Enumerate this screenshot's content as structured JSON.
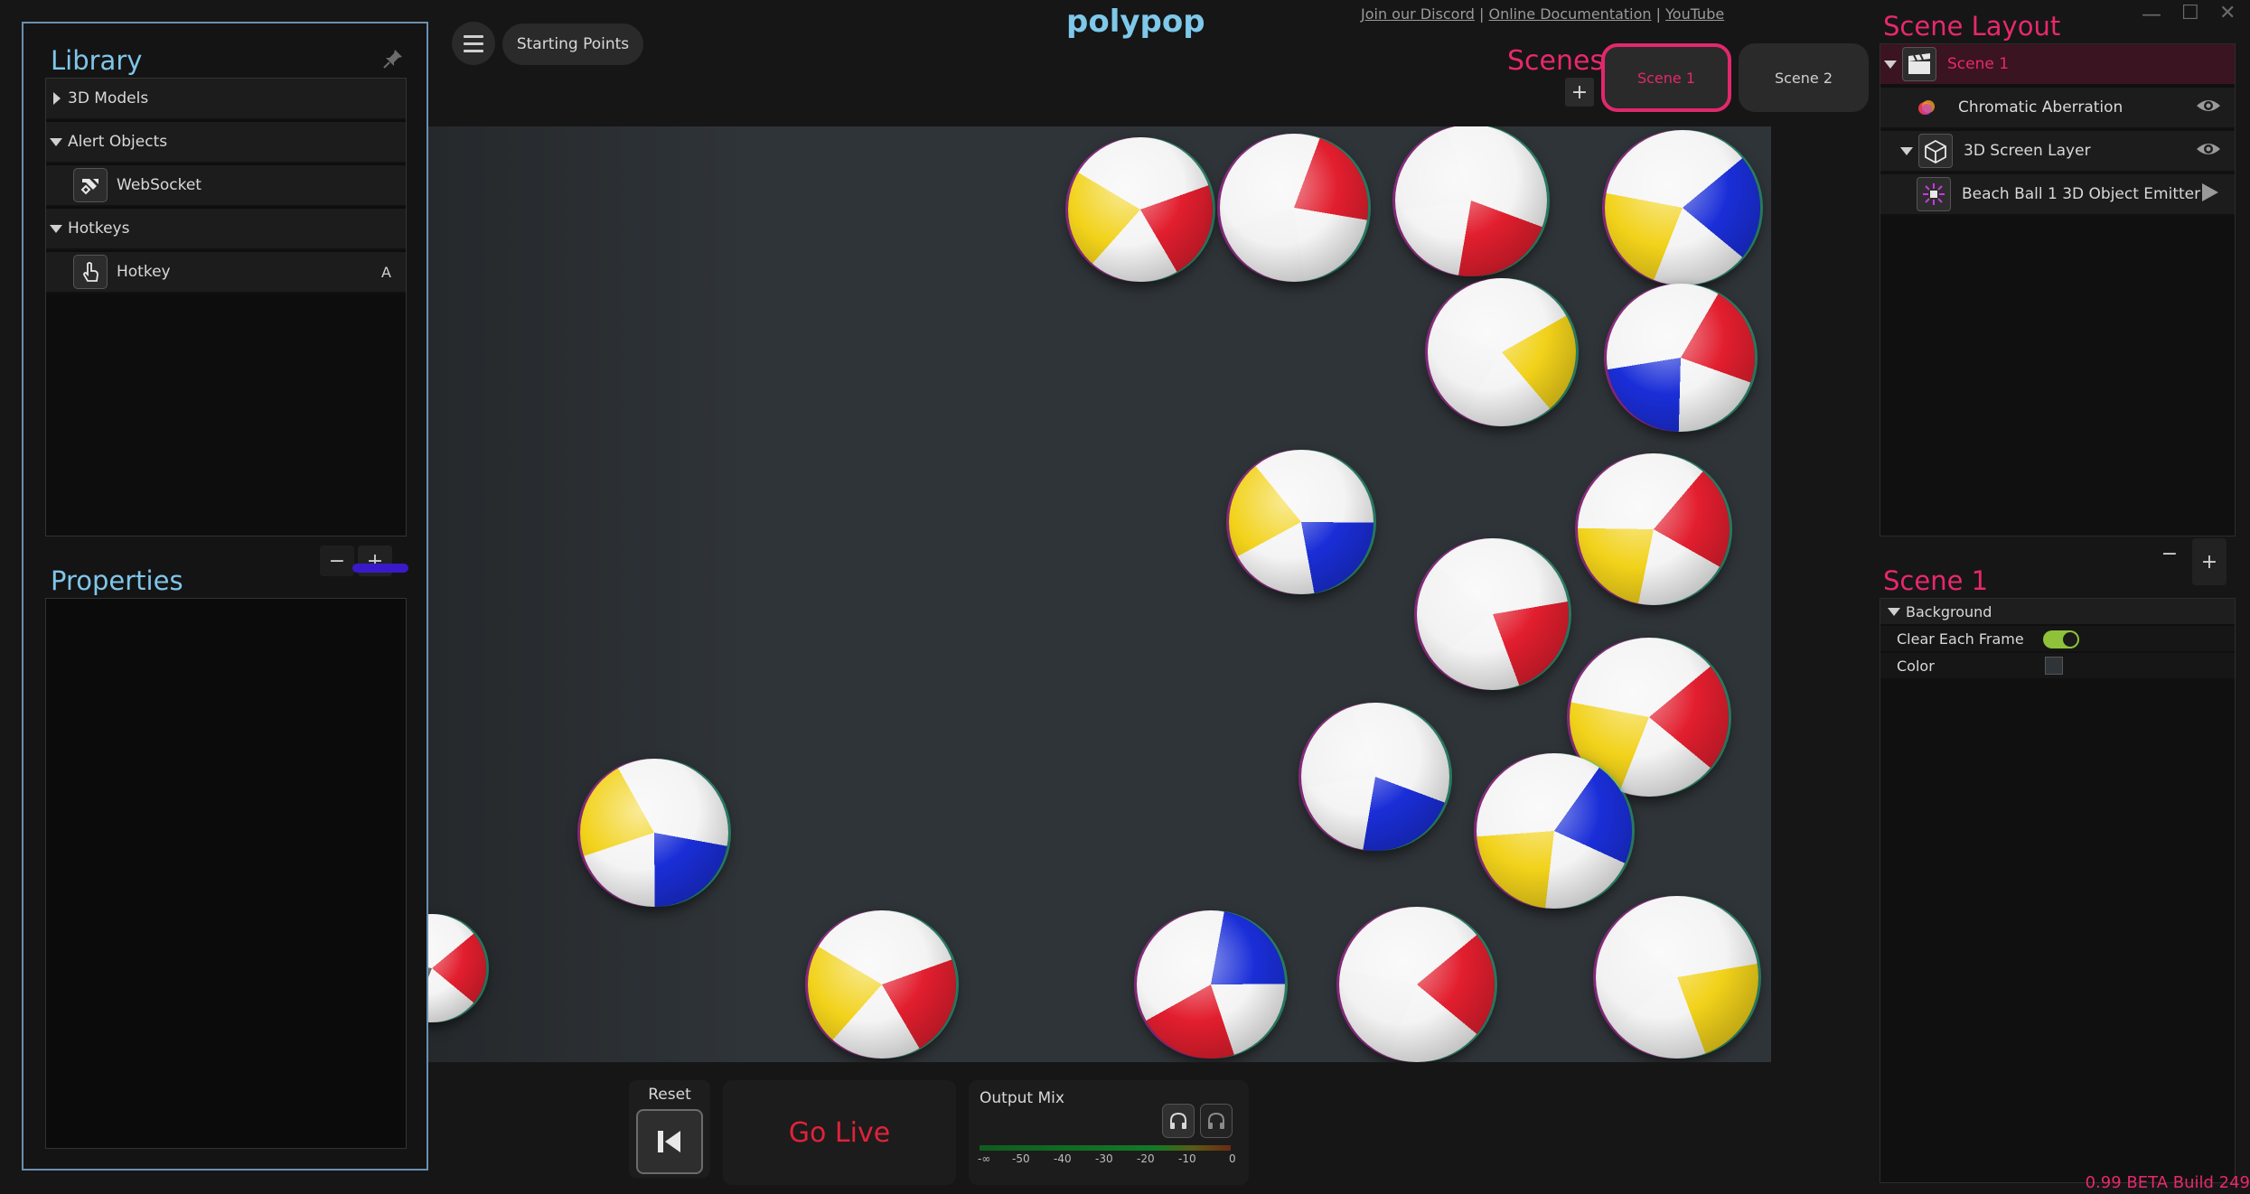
{
  "app": {
    "logo": "polypop",
    "build": "0.99 BETA Build 249"
  },
  "top_links": {
    "discord": "Join our Discord",
    "docs": "Online Documentation",
    "youtube": "YouTube",
    "separator": "|"
  },
  "toolbar": {
    "starting_points": "Starting Points"
  },
  "library": {
    "title": "Library",
    "rows": [
      {
        "label": "3D Models",
        "type": "category-collapsed"
      },
      {
        "label": "Alert Objects",
        "type": "category-expanded"
      },
      {
        "label": "WebSocket",
        "type": "item",
        "icon": "websocket-icon"
      },
      {
        "label": "Hotkeys",
        "type": "category-expanded"
      },
      {
        "label": "Hotkey",
        "type": "item",
        "icon": "hand-pointer-icon",
        "key": "A"
      }
    ],
    "remove_label": "−",
    "add_label": "+"
  },
  "properties": {
    "title": "Properties"
  },
  "scenes": {
    "label": "Scenes",
    "add_label": "+",
    "items": [
      {
        "label": "Scene 1",
        "active": true
      },
      {
        "label": "Scene 2",
        "active": false
      }
    ]
  },
  "scene_layout": {
    "title": "Scene Layout",
    "rows": [
      {
        "label": "Scene 1",
        "icon": "clapperboard-icon",
        "selected": true
      },
      {
        "label": "Chromatic Aberration",
        "icon": "chromatic-aberration-icon"
      },
      {
        "label": "3D Screen Layer",
        "icon": "cube-icon"
      },
      {
        "label": "Beach Ball 1 3D Object Emitter",
        "icon": "emitter-icon"
      }
    ],
    "remove_label": "−",
    "add_label": "+"
  },
  "scene_props": {
    "title": "Scene 1",
    "section": "Background",
    "clear_each_frame_label": "Clear Each Frame",
    "clear_each_frame": true,
    "color_label": "Color",
    "color_value": "#2f3438"
  },
  "controls": {
    "reset_label": "Reset",
    "go_live": "Go Live",
    "output_mix": "Output Mix",
    "meter_ticks": [
      "-∞",
      "-50",
      "-40",
      "-30",
      "-20",
      "-10",
      "0"
    ]
  },
  "colors": {
    "accent_pink": "#e8286c",
    "accent_blue": "#7fc6ea",
    "stage_bg": "#2f3438",
    "go_live_red": "#e0223a",
    "toggle_on": "#8fc23a"
  }
}
